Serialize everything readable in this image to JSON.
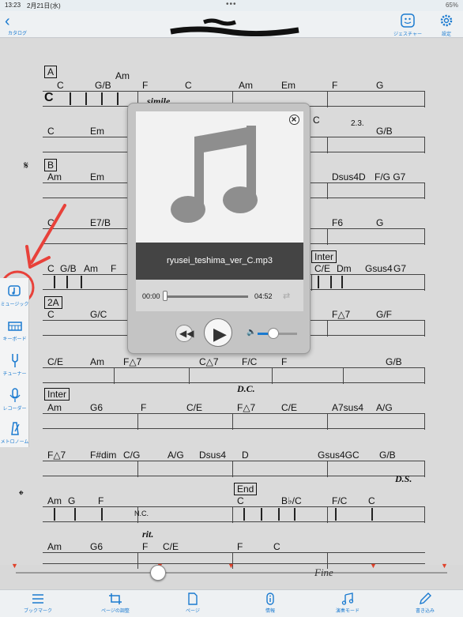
{
  "status": {
    "time": "13:23",
    "date": "2月21日(水)",
    "battery": "65%"
  },
  "nav": {
    "back_label": "カタログ",
    "gesture_label": "ジェスチャー",
    "settings_label": "設定"
  },
  "score": {
    "rehearsal_A": "A",
    "rehearsal_B": "B",
    "rehearsal_2A": "2A",
    "rehearsal_inter": "Inter",
    "rehearsal_inter2": "Inter",
    "rehearsal_end": "End",
    "time_sig_common": "C",
    "simile": "simile",
    "dc": "D.C.",
    "ds": "D.S.",
    "ritardando": "rit.",
    "fine": "Fine",
    "nc": "N.C.",
    "ending": "2.3.",
    "row1": [
      "C",
      "G/B",
      "Am",
      "F",
      "C",
      "Am",
      "Em",
      "F",
      "G"
    ],
    "row2": [
      "C",
      "Em",
      "C",
      "G/B"
    ],
    "row3": [
      "Am",
      "Em",
      "Dsus4D",
      "F/G G7"
    ],
    "row4": [
      "C",
      "E7/B",
      "F6",
      "G"
    ],
    "row5": [
      "C",
      "G/B",
      "Am",
      "F",
      "C/E",
      "Dm",
      "Gsus4",
      "G7"
    ],
    "row6": [
      "C",
      "G/C",
      "F△7",
      "G/F"
    ],
    "row7": [
      "C/E",
      "Am",
      "F△7",
      "C△7",
      "F/C",
      "F",
      "G/B"
    ],
    "row8": [
      "Am",
      "G6",
      "F",
      "C/E",
      "F△7",
      "C/E",
      "A7sus4",
      "A/G"
    ],
    "row9": [
      "F△7",
      "F#dim",
      "C/G",
      "A/G",
      "Dsus4",
      "D",
      "Gsus4G",
      "C",
      "G/B"
    ],
    "row10": [
      "Am",
      "G",
      "F",
      "C",
      "B♭/C",
      "F/C",
      "C"
    ],
    "row11": [
      "Am",
      "G6",
      "F",
      "C/E",
      "F",
      "C"
    ]
  },
  "player": {
    "track": "ryusei_teshima_ver_C.mp3",
    "elapsed": "00:00",
    "duration": "04:52",
    "progress": 0.0,
    "volume": 0.4
  },
  "sidebar": {
    "music": "ミュージック",
    "keyboard": "キーボード",
    "tuner": "チューナー",
    "recorder": "レコーダー",
    "metronome": "メトロノーム"
  },
  "toolbar": {
    "bookmark": "ブックマーク",
    "page_adjust": "ページの調整",
    "page": "ページ",
    "info": "情報",
    "play_mode": "演奏モード",
    "write": "書き込み"
  },
  "seek": {
    "position": 0.33
  }
}
